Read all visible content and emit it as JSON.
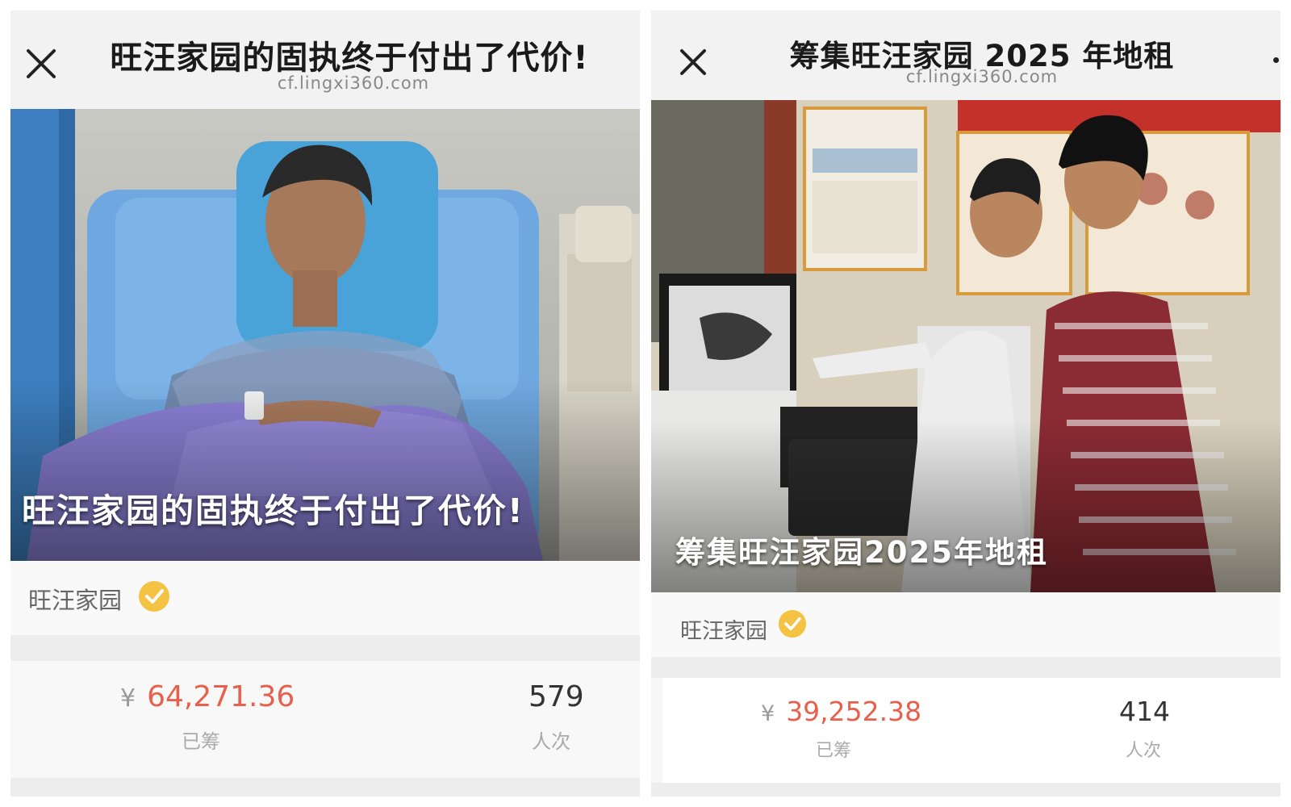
{
  "left_card": {
    "header": {
      "title": "旺汪家园的固执终于付出了代价!",
      "domain": "cf.lingxi360.com"
    },
    "hero": {
      "caption": "旺汪家园的固执终于付出了代价!"
    },
    "org": {
      "name": "旺汪家园",
      "verified_icon": "verified-check-icon"
    },
    "stats": {
      "currency": "¥",
      "amount": "64,271.36",
      "amount_label": "已筹",
      "count": "579",
      "count_label": "人次"
    }
  },
  "right_card": {
    "header": {
      "title": "筹集旺汪家园 2025 年地租",
      "domain": "cf.lingxi360.com"
    },
    "hero": {
      "caption": "筹集旺汪家园2025年地租"
    },
    "org": {
      "name": "旺汪家园",
      "verified_icon": "verified-check-icon"
    },
    "stats": {
      "currency": "¥",
      "amount": "39,252.38",
      "amount_label": "已筹",
      "count": "414",
      "count_label": "人次"
    }
  },
  "colors": {
    "amount": "#e8604c",
    "verified_badge": "#f5c343",
    "header_bg": "#f2f2f2"
  }
}
